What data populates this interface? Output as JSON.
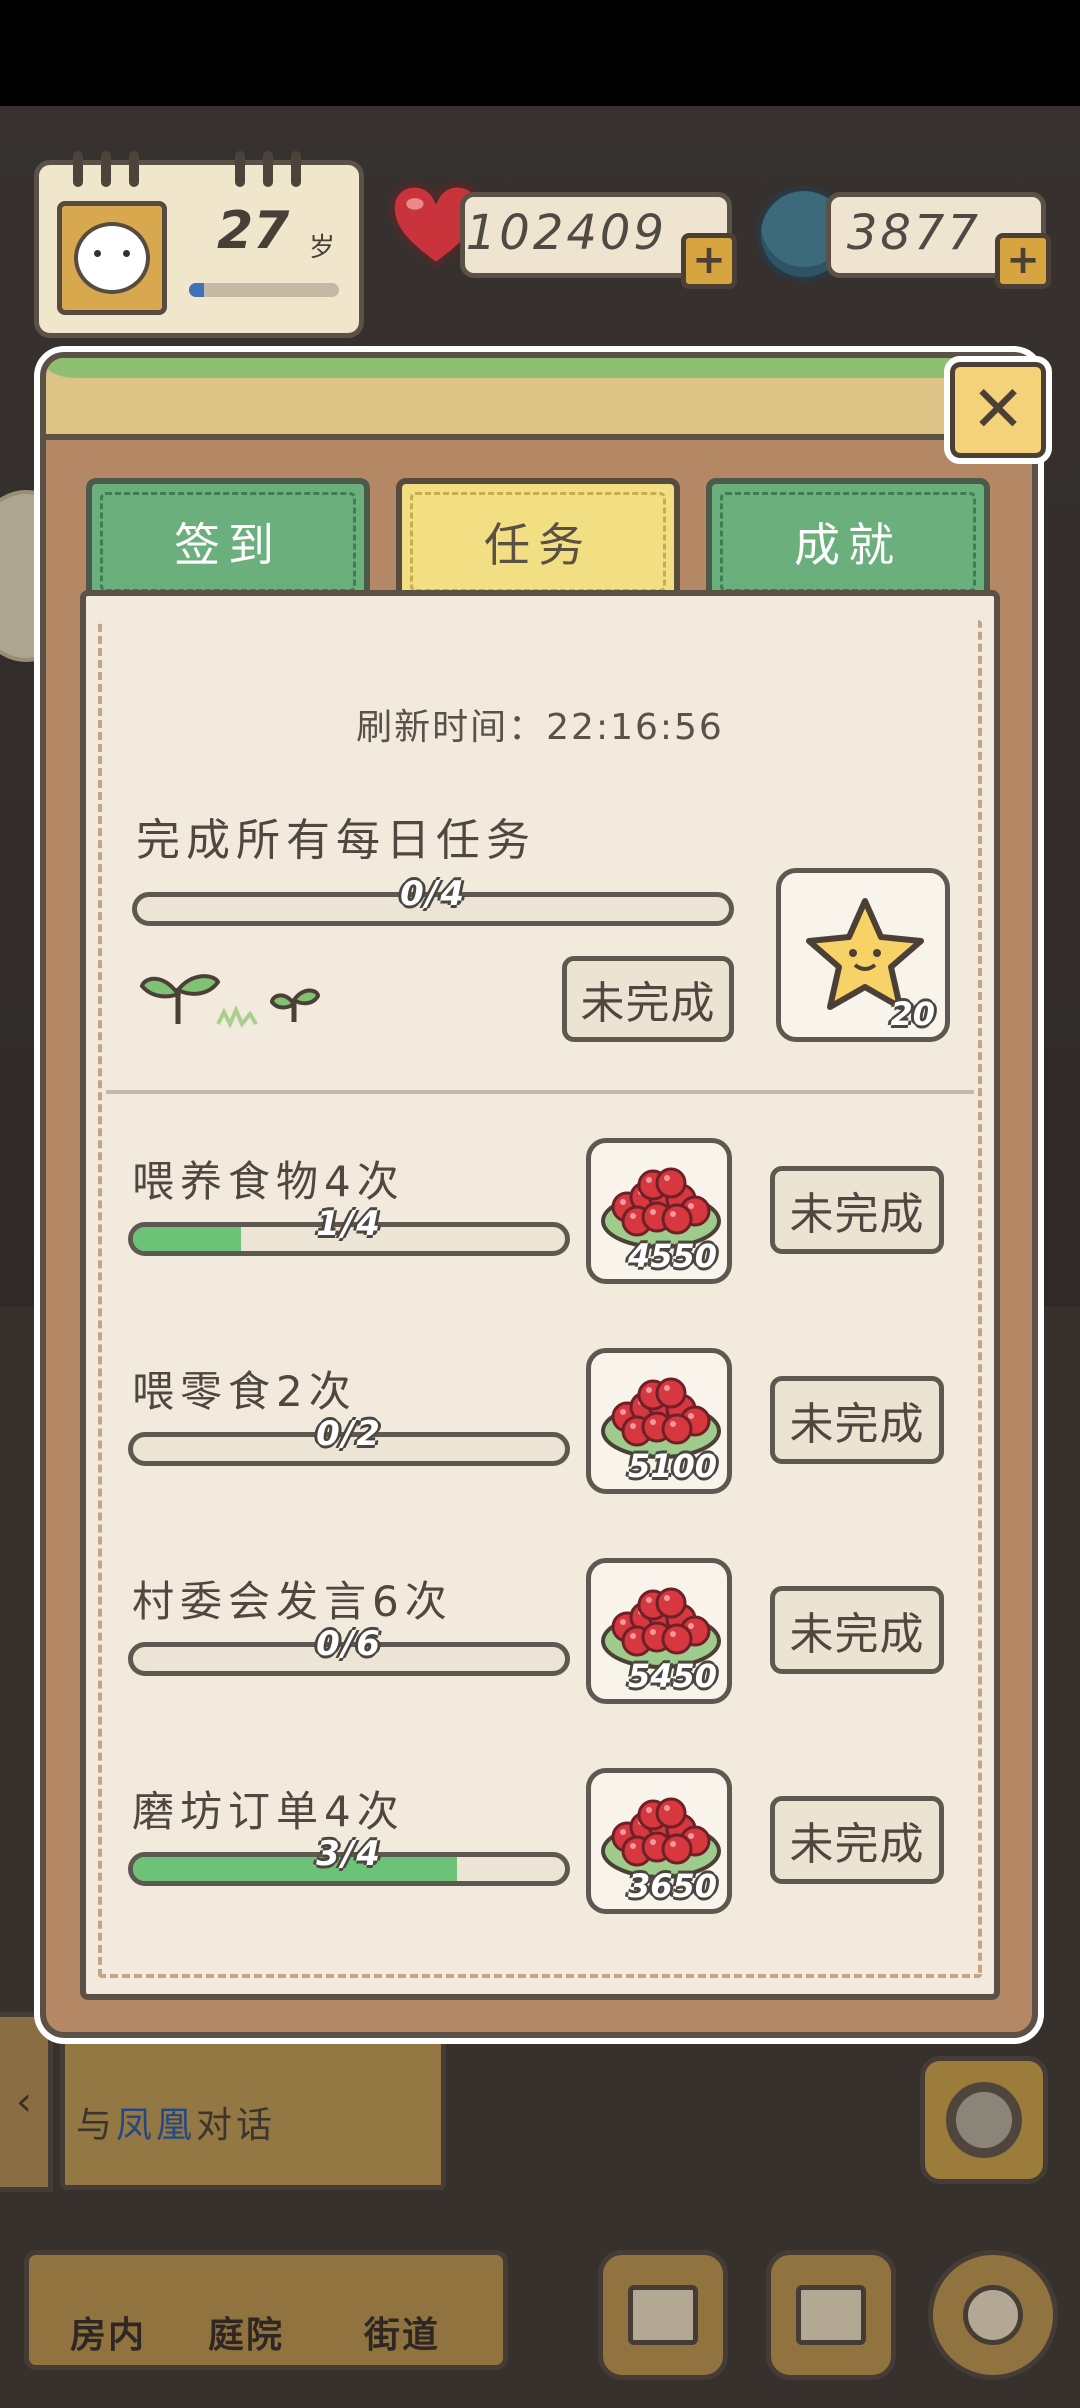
{
  "hud": {
    "age": "27",
    "age_unit": "岁",
    "age_progress": 0.1,
    "hearts": "102409",
    "coins": "3877",
    "plus_label": "+"
  },
  "panel": {
    "close_label": "✕",
    "tabs": [
      {
        "label": "签到",
        "active": false
      },
      {
        "label": "任务",
        "active": true
      },
      {
        "label": "成就",
        "active": false
      }
    ],
    "refresh_text": "刷新时间：22:16:56",
    "daily_all": {
      "title": "完成所有每日任务",
      "progress_label": "0/4",
      "progress": 0,
      "status": "未完成",
      "reward_amount": "20",
      "reward_icon": "star-icon"
    },
    "tasks": [
      {
        "title": "喂养食物4次",
        "progress_label": "1/4",
        "progress": 0.25,
        "reward_amount": "4550",
        "reward_icon": "berries-icon",
        "status": "未完成"
      },
      {
        "title": "喂零食2次",
        "progress_label": "0/2",
        "progress": 0,
        "reward_amount": "5100",
        "reward_icon": "berries-icon",
        "status": "未完成"
      },
      {
        "title": "村委会发言6次",
        "progress_label": "0/6",
        "progress": 0,
        "reward_amount": "5450",
        "reward_icon": "berries-icon",
        "status": "未完成"
      },
      {
        "title": "磨坊订单4次",
        "progress_label": "3/4",
        "progress": 0.75,
        "reward_amount": "3650",
        "reward_icon": "berries-icon",
        "status": "未完成"
      }
    ]
  },
  "background": {
    "dialog_prefix": "与",
    "dialog_highlight": "凤凰",
    "dialog_suffix": "对话",
    "nav": [
      "房内",
      "庭院",
      "街道"
    ]
  },
  "colors": {
    "tab_green": "#6bb07c",
    "tab_active": "#f2df83",
    "progress_fill": "#6cc377",
    "panel_bg": "#f2ebdd"
  }
}
